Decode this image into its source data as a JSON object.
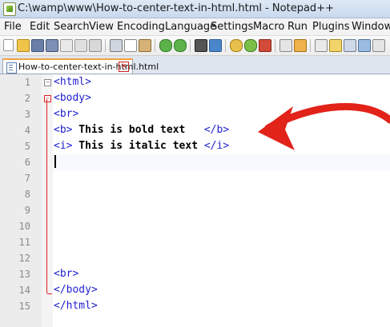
{
  "window": {
    "title": "C:\\wamp\\www\\How-to-center-text-in-html.html - Notepad++"
  },
  "menu": [
    "File",
    "Edit",
    "Search",
    "View",
    "Encoding",
    "Language",
    "Settings",
    "Macro",
    "Run",
    "Plugins",
    "Window"
  ],
  "tab": {
    "label": "How-to-center-text-in-html.html",
    "close": "×"
  },
  "editor": {
    "line_numbers": [
      "1",
      "2",
      "3",
      "4",
      "5",
      "6",
      "7",
      "8",
      "9",
      "10",
      "11",
      "12",
      "13",
      "14",
      "15"
    ],
    "lines": {
      "l1": "<html>",
      "l2": "<body>",
      "l3": "<br>",
      "l4_open": "<b>",
      "l4_text": " This is bold text   ",
      "l4_close": "</b>",
      "l5_open": "<i>",
      "l5_text": " This is italic text ",
      "l5_close": "</i>",
      "l13": "<br>",
      "l14": "</body>",
      "l15": "</html>"
    }
  },
  "colors": {
    "tag": "#1f1fd1",
    "fold_marker": "#d22222",
    "annotation_arrow": "#e2231a",
    "tab_accent": "#f2a23b"
  },
  "icons": [
    "app-icon",
    "new-file-icon",
    "open-icon",
    "save-icon",
    "save-all-icon",
    "close-icon",
    "close-all-icon",
    "print-icon",
    "cut-icon",
    "copy-icon",
    "paste-icon",
    "undo-icon",
    "redo-icon",
    "find-icon",
    "replace-icon",
    "zoom-in-icon",
    "zoom-out-icon",
    "sync-icon",
    "wrap-icon",
    "indent-icon",
    "show-all-icon"
  ]
}
